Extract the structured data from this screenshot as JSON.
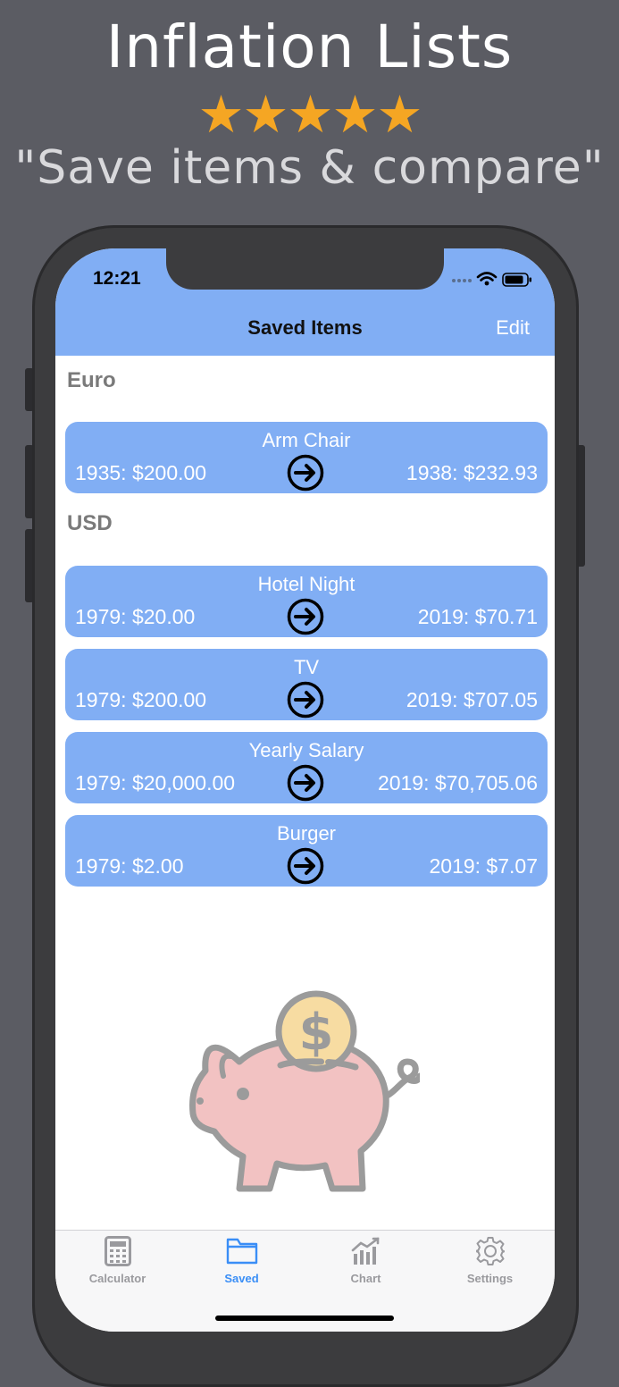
{
  "promo": {
    "headline": "Inflation Lists",
    "stars": "★★★★★",
    "tagline": "\"Save items & compare\""
  },
  "status_bar": {
    "time": "12:21"
  },
  "navbar": {
    "title": "Saved Items",
    "edit_label": "Edit"
  },
  "sections": [
    {
      "header": "Euro",
      "items": [
        {
          "name": "Arm Chair",
          "from": "1935: $200.00",
          "to": "1938: $232.93"
        }
      ]
    },
    {
      "header": "USD",
      "items": [
        {
          "name": "Hotel Night",
          "from": "1979: $20.00",
          "to": "2019: $70.71"
        },
        {
          "name": "TV",
          "from": "1979: $200.00",
          "to": "2019: $707.05"
        },
        {
          "name": "Yearly Salary",
          "from": "1979: $20,000.00",
          "to": "2019: $70,705.06"
        },
        {
          "name": "Burger",
          "from": "1979: $2.00",
          "to": "2019: $7.07"
        }
      ]
    }
  ],
  "tabbar": {
    "tabs": [
      {
        "label": "Calculator",
        "icon": "calculator-icon"
      },
      {
        "label": "Saved",
        "icon": "folder-icon",
        "active": true
      },
      {
        "label": "Chart",
        "icon": "chart-icon"
      },
      {
        "label": "Settings",
        "icon": "gear-icon"
      }
    ]
  },
  "colors": {
    "accent": "#81aef4",
    "active_tab": "#3a8ef6",
    "inactive_tab": "#9a9a9e",
    "stars": "#f5a623"
  }
}
